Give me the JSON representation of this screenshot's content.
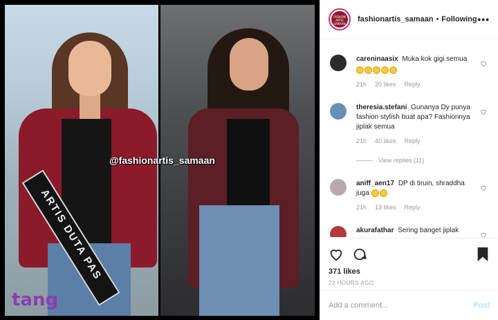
{
  "media": {
    "left_logo": "tang",
    "left_sash_text": "ARTIS DUTA PAS",
    "watermark": "@fashionartis_samaan"
  },
  "header": {
    "username": "fashionartis_samaan",
    "separator": "•",
    "follow_status": "Following",
    "more_icon": "more-horizontal-icon",
    "avatar_text": "FASHION ARTIS SAMAAN"
  },
  "comments": [
    {
      "user": "careninaasix",
      "text": "Muka kok gigi semua",
      "emoji_count": 5,
      "time": "21h",
      "likes": "20 likes",
      "reply": "Reply",
      "avatar_color": "#2b2b2b"
    },
    {
      "user": "theresia.stefani",
      "text": "Gunanya Dy punya fashion stylish buat apa? Fashionnya jiplak semua",
      "time": "21h",
      "likes": "40 likes",
      "reply": "Reply",
      "avatar_color": "#6a8fb6"
    },
    {
      "user": "aniff_aen17",
      "text": "DP di tiruin, shraddha juga",
      "emoji_count": 2,
      "time": "21h",
      "likes": "13 likes",
      "reply": "Reply",
      "avatar_color": "#b9a7b0"
    },
    {
      "user": "akurafathar",
      "text": "Sering banget jiplak",
      "avatar_color": "#b33a3a"
    }
  ],
  "view_replies": "View replies (11)",
  "actions": {
    "likes": "371 likes",
    "time_ago": "22 HOURS AGO"
  },
  "add_comment": {
    "placeholder": "Add a comment...",
    "post_label": "Post"
  },
  "colors": {
    "link_disabled": "#b2dffc",
    "meta": "#999999",
    "text": "#262626"
  }
}
